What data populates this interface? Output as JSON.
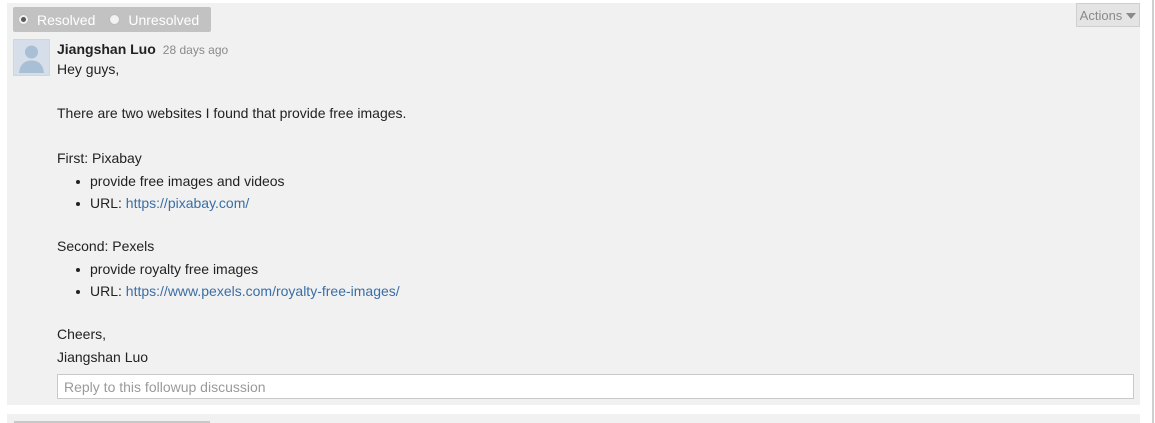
{
  "filter": {
    "resolved_label": "Resolved",
    "unresolved_label": "Unresolved",
    "selected": "Resolved"
  },
  "actions": {
    "label": "Actions"
  },
  "post": {
    "author": "Jiangshan Luo",
    "time": "28 days ago",
    "greeting": "Hey guys,",
    "intro": "There are two websites I found that provide free images.",
    "first_heading": "First: Pixabay",
    "first_items": {
      "desc": "provide free images and videos",
      "url_label": "URL: ",
      "url": "https://pixabay.com/"
    },
    "second_heading": "Second: Pexels",
    "second_items": {
      "desc": "provide royalty free images",
      "url_label": "URL: ",
      "url": "https://www.pexels.com/royalty-free-images/"
    },
    "signoff": "Cheers,",
    "signature": "Jiangshan Luo"
  },
  "reply": {
    "placeholder": "Reply to this followup discussion",
    "value": ""
  },
  "colors": {
    "link": "#3a6ea5",
    "panel_bg": "#f1f1f1",
    "filter_bg": "#c2c2c2"
  }
}
